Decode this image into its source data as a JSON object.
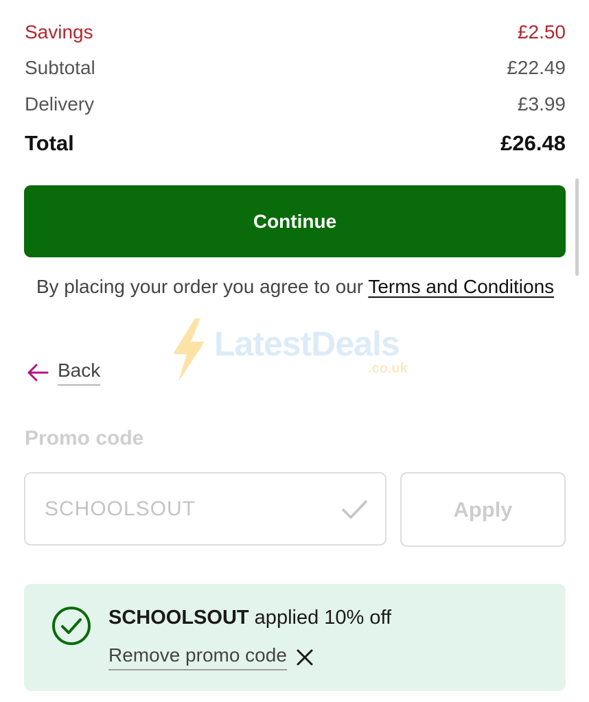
{
  "summary": {
    "savings_label": "Savings",
    "savings_value": "£2.50",
    "subtotal_label": "Subtotal",
    "subtotal_value": "£22.49",
    "delivery_label": "Delivery",
    "delivery_value": "£3.99",
    "total_label": "Total",
    "total_value": "£26.48"
  },
  "continue_label": "Continue",
  "terms": {
    "text": "By placing your order you agree to our ",
    "link": "Terms and Conditions"
  },
  "watermark": {
    "brand": "LatestDeals",
    "domain": ".co.uk"
  },
  "back_label": "Back",
  "promo": {
    "heading": "Promo code",
    "input_value": "SCHOOLSOUT",
    "apply_label": "Apply",
    "applied_code": "SCHOOLSOUT",
    "applied_text": " applied 10% off",
    "remove_label": "Remove promo code"
  },
  "colors": {
    "savings": "#b3262d",
    "primary_button": "#0a6b0a",
    "success_banner": "#e3f4ec",
    "success_icon": "#0a6b0a",
    "back_arrow": "#b0177d"
  },
  "icons": [
    "back-arrow-icon",
    "check-icon",
    "success-check-circle-icon",
    "close-icon",
    "lightning-bolt-icon"
  ]
}
